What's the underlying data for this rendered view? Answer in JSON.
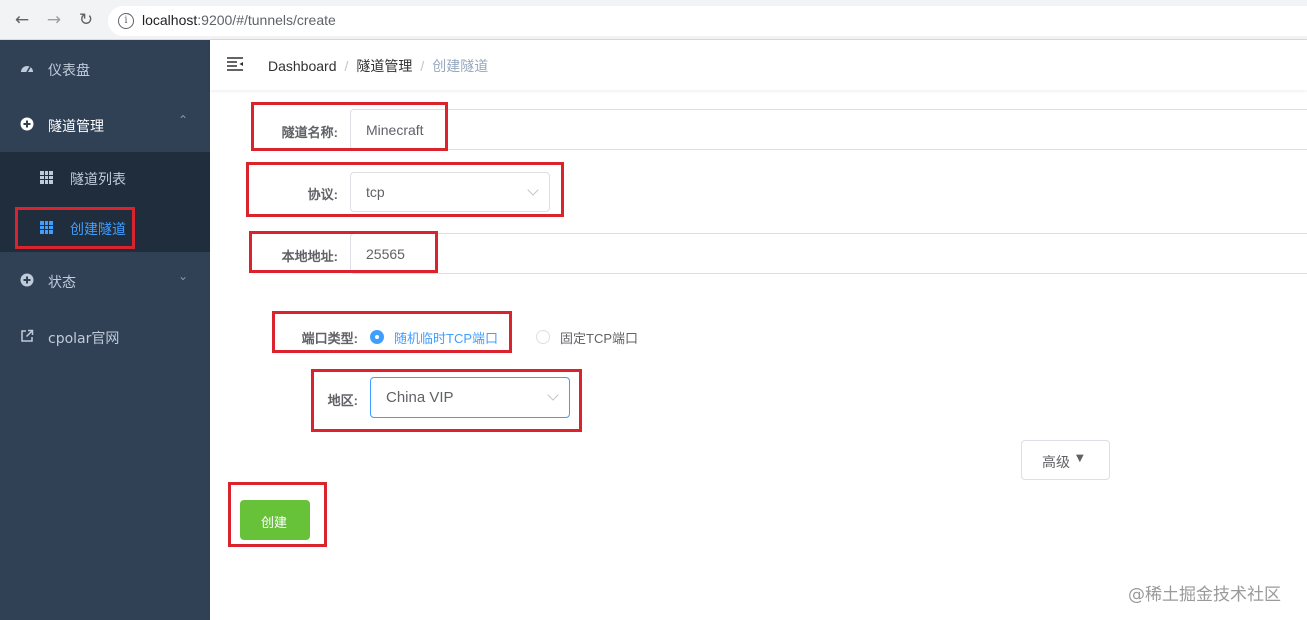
{
  "browser": {
    "url_host": "localhost",
    "url_rest": ":9200/#/tunnels/create"
  },
  "sidebar": {
    "items": [
      {
        "label": "仪表盘",
        "icon": "dashboard-icon"
      },
      {
        "label": "隧道管理",
        "icon": "tunnel-icon",
        "expanded": true
      },
      {
        "label": "状态",
        "icon": "status-icon"
      },
      {
        "label": "cpolar官网",
        "icon": "external-link-icon"
      }
    ],
    "subitems": [
      {
        "label": "隧道列表",
        "icon": "grid-icon"
      },
      {
        "label": "创建隧道",
        "icon": "grid-icon",
        "active": true
      }
    ]
  },
  "breadcrumb": [
    "Dashboard",
    "隧道管理",
    "创建隧道"
  ],
  "form": {
    "name_label": "隧道名称:",
    "name_value": "Minecraft",
    "protocol_label": "协议:",
    "protocol_value": "tcp",
    "local_label": "本地地址:",
    "local_value": "25565",
    "port_type_label": "端口类型:",
    "port_type_options": [
      "随机临时TCP端口",
      "固定TCP端口"
    ],
    "port_type_selected": "随机临时TCP端口",
    "region_label": "地区:",
    "region_value": "China VIP",
    "advanced_label": "高级",
    "create_label": "创建"
  },
  "watermark": "@稀土掘金技术社区",
  "colors": {
    "sidebar_bg": "#304156",
    "submenu_bg": "#1f2d3d",
    "accent": "#409eff",
    "success": "#67c23a",
    "highlight_box": "#d9232d"
  }
}
